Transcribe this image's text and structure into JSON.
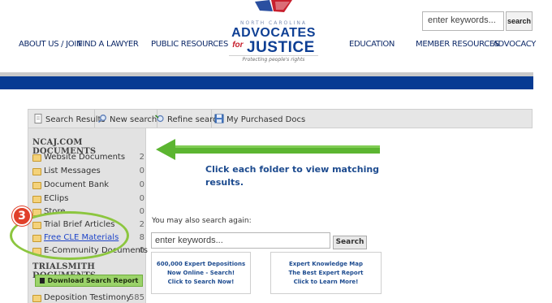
{
  "header": {
    "search_placeholder": "enter keywords...",
    "search_button": "search",
    "logo": {
      "line1": "NORTH CAROLINA",
      "line2": "ADVOCATES",
      "line3_prefix": "for",
      "line3": "JUSTICE",
      "tagline": "Protecting people's rights"
    },
    "nav": [
      "ABOUT US / JOIN",
      "FIND A LAWYER",
      "PUBLIC RESOURCES",
      "EDUCATION",
      "MEMBER RESOURCES",
      "ADVOCACY"
    ]
  },
  "toolbar": {
    "items": [
      "Search Results",
      "New search",
      "Refine search",
      "My Purchased Docs"
    ]
  },
  "sidebar": {
    "section1_title": "NCAJ.COM DOCUMENTS",
    "section1_folders": [
      {
        "label": "Website Documents",
        "count": "2"
      },
      {
        "label": "List Messages",
        "count": "0"
      },
      {
        "label": "Document Bank",
        "count": "0"
      },
      {
        "label": "EClips",
        "count": "0"
      },
      {
        "label": "Store",
        "count": "0"
      },
      {
        "label": "Trial Brief Articles",
        "count": "2"
      },
      {
        "label": "Free CLE Materials",
        "count": "8"
      },
      {
        "label": "E-Community Documents",
        "count": "0"
      }
    ],
    "section2_title": "TRIALSMITH DOCUMENTS",
    "download_button": "Download Search Report",
    "section2_folders": [
      {
        "label": "Deposition Testimony",
        "count": "585"
      }
    ]
  },
  "annotation": {
    "step_number": "3",
    "arrow_color": "#5cb531",
    "badge_color": "#e0402a"
  },
  "main": {
    "instruction": "Click each folder to view matching results.",
    "search_again_label": "You may also search again:",
    "search_again_value": "enter keywords...",
    "search_again_button": "Search",
    "promo1": [
      "600,000 Expert Depositions",
      "Now Online - Search!",
      "Click to Search Now!"
    ],
    "promo2": [
      "Expert Knowledge Map",
      "The Best Expert Report",
      "Click to Learn More!"
    ]
  },
  "colors": {
    "nav_text": "#0e2a69",
    "blue_band": "#073b93",
    "link": "#1f45c8"
  }
}
